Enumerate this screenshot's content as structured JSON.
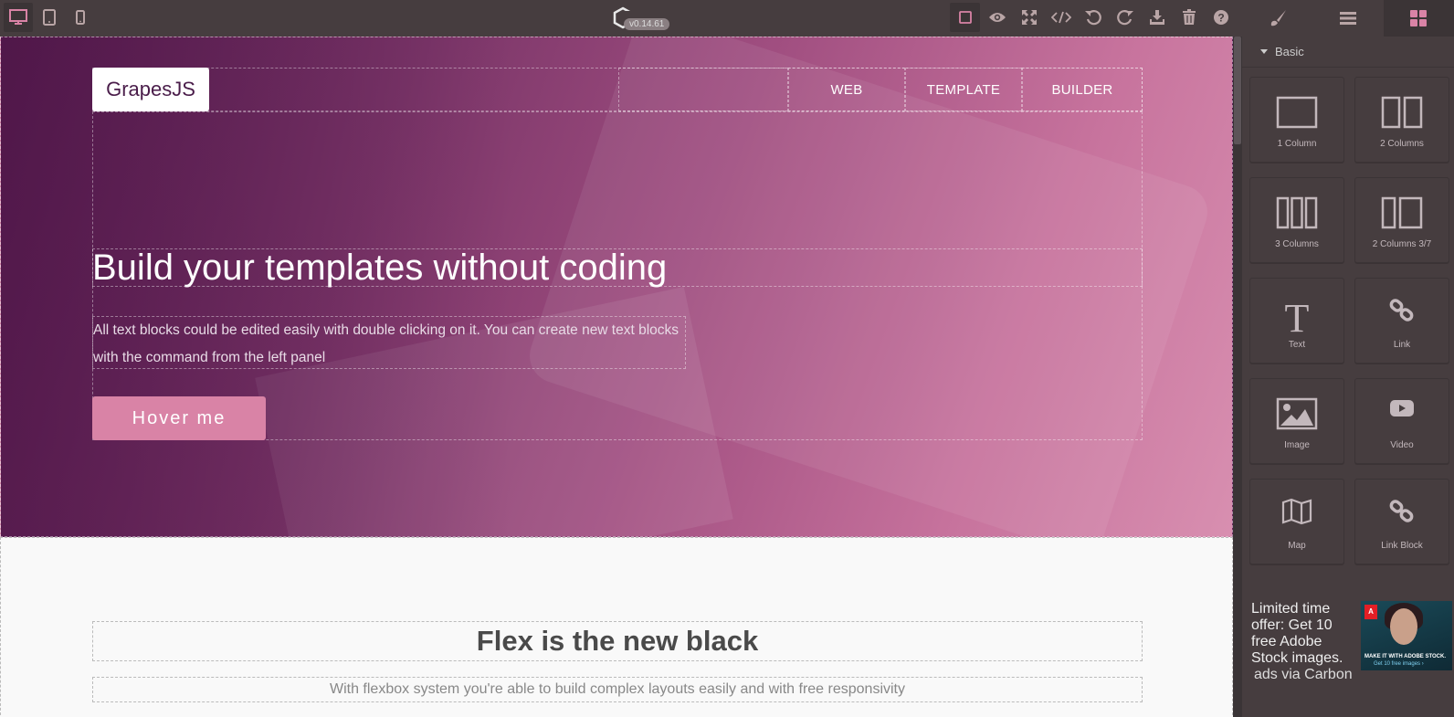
{
  "app": {
    "version": "v0.14.61"
  },
  "toolbar": {
    "devices": [
      {
        "name": "desktop",
        "active": true
      },
      {
        "name": "tablet",
        "active": false
      },
      {
        "name": "mobile",
        "active": false
      }
    ],
    "options": [
      "sw-visibility",
      "preview",
      "fullscreen",
      "export-code",
      "undo",
      "redo",
      "import",
      "clear-canvas",
      "help"
    ],
    "views": [
      "style-manager",
      "layer-manager",
      "blocks"
    ]
  },
  "canvas": {
    "header": {
      "brand": "GrapesJS",
      "nav": [
        "WEB",
        "TEMPLATE",
        "BUILDER"
      ]
    },
    "hero": {
      "title": "Build your templates without coding",
      "text": "All text blocks could be edited easily with double clicking on it. You can create new text blocks with the command from the left panel",
      "button": "Hover me"
    },
    "section2": {
      "title": "Flex is the new black",
      "subtitle": "With flexbox system you're able to build complex layouts easily and with free responsivity"
    }
  },
  "blocks_panel": {
    "category": "Basic",
    "blocks": [
      {
        "label": "1 Column",
        "icon": "one-column-icon"
      },
      {
        "label": "2 Columns",
        "icon": "two-columns-icon"
      },
      {
        "label": "3 Columns",
        "icon": "three-columns-icon"
      },
      {
        "label": "2 Columns 3/7",
        "icon": "two-columns-3-7-icon"
      },
      {
        "label": "Text",
        "icon": "text-icon"
      },
      {
        "label": "Link",
        "icon": "link-icon"
      },
      {
        "label": "Image",
        "icon": "image-icon"
      },
      {
        "label": "Video",
        "icon": "video-icon"
      },
      {
        "label": "Map",
        "icon": "map-icon"
      },
      {
        "label": "Link Block",
        "icon": "link-block-icon"
      }
    ]
  },
  "ad": {
    "text": "Limited time offer: Get 10 free Adobe Stock images.",
    "credit": "ads via Carbon",
    "image_tagline": "MAKE IT WITH ADOBE STOCK.",
    "image_cta": "Get 10 free images ›",
    "image_logo": "A"
  },
  "colors": {
    "accent": "#d983a6",
    "panel_bg": "#463d3f",
    "hero_dark": "#5a1f52"
  }
}
